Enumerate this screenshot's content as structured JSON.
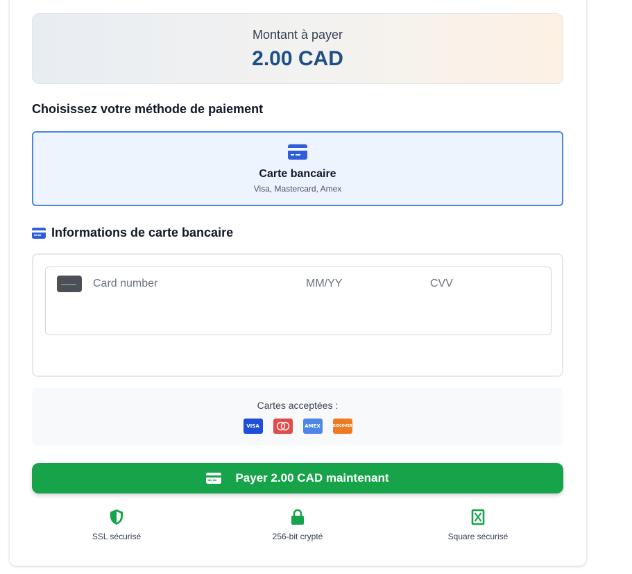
{
  "amount": {
    "label": "Montant à payer",
    "value": "2.00 CAD"
  },
  "method_section": {
    "title": "Choisissez votre méthode de paiement"
  },
  "method": {
    "name": "Carte bancaire",
    "subtitle": "Visa, Mastercard, Amex",
    "icon": "credit-card-icon"
  },
  "card_info": {
    "title": "Informations de carte bancaire",
    "icon": "credit-card-icon",
    "card_number_placeholder": "Card number",
    "expiry_placeholder": "MM/YY",
    "cvv_placeholder": "CVV"
  },
  "accepted_cards": {
    "label": "Cartes acceptées :",
    "brands": [
      "VISA",
      "Mastercard",
      "AMEX",
      "DISCOVER"
    ]
  },
  "pay_button": {
    "label": "Payer 2.00 CAD maintenant"
  },
  "badges": [
    {
      "label": "SSL sécurisé",
      "icon": "shield-icon"
    },
    {
      "label": "256-bit crypté",
      "icon": "lock-icon"
    },
    {
      "label": "Square sécurisé",
      "icon": "square-icon"
    }
  ],
  "colors": {
    "primary_blue": "#2f5fd8",
    "amount_text": "#1e4f86",
    "success_green": "#17a34a",
    "selected_border": "#4a86e0"
  }
}
